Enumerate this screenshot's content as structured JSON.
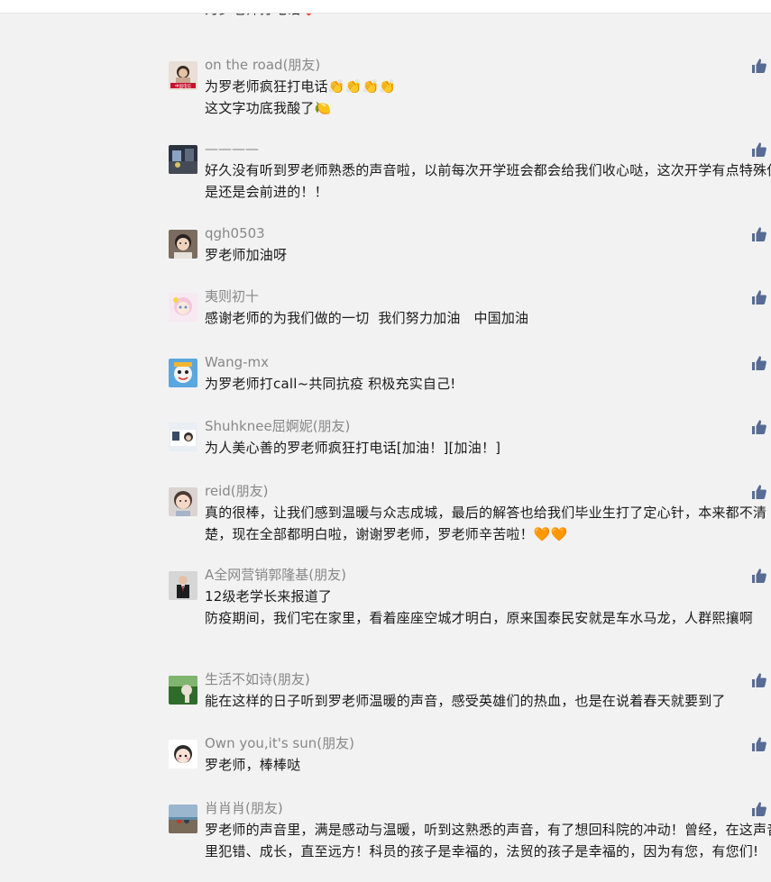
{
  "colors": {
    "background": "#f2f2f2",
    "nickname": "#888888",
    "content": "#1a1a1a",
    "like_icon": "#576b95",
    "heart": "#d2161c",
    "orange_heart": "#f26d21"
  },
  "comments": [
    {
      "nickname": "",
      "content": "为罗老师打电话❤️",
      "avatar_icon": "avatar-partial-icon",
      "has_like": false
    },
    {
      "nickname": "on the road(朋友)",
      "content": "为罗老师疯狂打电话👏👏👏👏\n这文字功底我酸了🍋",
      "avatar_icon": "avatar-woman-icon",
      "has_like": true
    },
    {
      "nickname": "————",
      "content": "好久没有听到罗老师熟悉的声音啦，以前每次开学班会都会给我们收心哒，这次开学有点特殊但是还是会前进的！！",
      "avatar_icon": "avatar-street-icon",
      "has_like": true
    },
    {
      "nickname": "qgh0503",
      "content": "罗老师加油呀",
      "avatar_icon": "avatar-boy-icon",
      "has_like": true
    },
    {
      "nickname": "夷则初十",
      "content": "感谢老师的为我们做的一切  我们努力加油   中国加油",
      "avatar_icon": "avatar-anime-icon",
      "has_like": true
    },
    {
      "nickname": "Wang-mx",
      "content": "为罗老师打call~共同抗疫 积极充实自己!",
      "avatar_icon": "avatar-cartoon-icon",
      "has_like": true
    },
    {
      "nickname": "Shuhknee屈婀妮(朋友)",
      "content": "为人美心善的罗老师疯狂打电话[加油！][加油！]",
      "avatar_icon": "avatar-landscape-icon",
      "has_like": true
    },
    {
      "nickname": "reid(朋友)",
      "content": "真的很棒，让我们感到温暖与众志成城，最后的解答也给我们毕业生打了定心针，本来都不清楚，现在全部都明白啦，谢谢罗老师，罗老师辛苦啦！🧡🧡",
      "avatar_icon": "avatar-child-icon",
      "has_like": true
    },
    {
      "nickname": "A全网营销郭隆基(朋友)",
      "content": "12级老学长来报道了\n防疫期间，我们宅在家里，看着座座空城才明白，原来国泰民安就是车水马龙，人群熙攘啊",
      "avatar_icon": "avatar-man-suit-icon",
      "has_like": true
    },
    {
      "nickname": "生活不如诗(朋友)",
      "content": "能在这样的日子听到罗老师温暖的声音，感受英雄们的热血，也是在说着春天就要到了",
      "avatar_icon": "avatar-nature-icon",
      "has_like": true
    },
    {
      "nickname": "Own you,it's sun(朋友)",
      "content": "罗老师，棒棒哒",
      "avatar_icon": "avatar-cute-icon",
      "has_like": true
    },
    {
      "nickname": "肖肖肖(朋友)",
      "content": "罗老师的声音里，满是感动与温暖，听到这熟悉的声音，有了想回科院的冲动！曾经，在这声音里犯错、成长，直至远方！科员的孩子是幸福的，法贸的孩子是幸福的，因为有您，有您们!",
      "avatar_icon": "avatar-beach-icon",
      "has_like": true
    }
  ]
}
